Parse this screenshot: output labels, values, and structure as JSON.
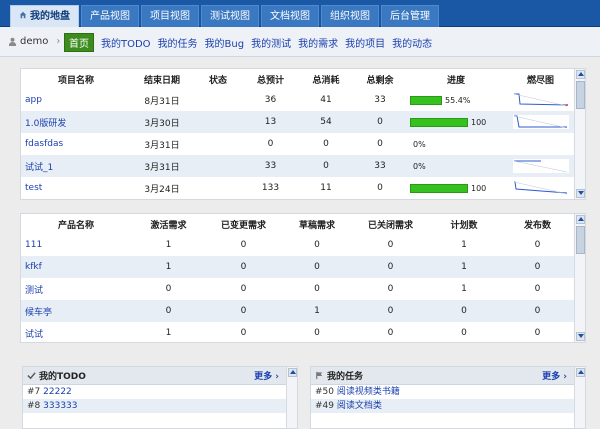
{
  "nav": {
    "tabs": [
      {
        "label": "我的地盘",
        "active": true
      },
      {
        "label": "产品视图"
      },
      {
        "label": "项目视图"
      },
      {
        "label": "测试视图"
      },
      {
        "label": "文档视图"
      },
      {
        "label": "组织视图"
      },
      {
        "label": "后台管理"
      }
    ]
  },
  "subnav": {
    "user": "demo",
    "separator": "›",
    "items": [
      "首页",
      "我的TODO",
      "我的任务",
      "我的Bug",
      "我的测试",
      "我的需求",
      "我的项目",
      "我的动态"
    ]
  },
  "projects": {
    "headers": [
      "项目名称",
      "结束日期",
      "状态",
      "总预计",
      "总消耗",
      "总剩余",
      "进度",
      "燃尽图"
    ],
    "rows": [
      {
        "name": "app",
        "end": "8月31日",
        "status": "",
        "estimate": "36",
        "consumed": "41",
        "left": "33",
        "progress": 55.4,
        "progress_label": "55.4%"
      },
      {
        "name": "1.0版研发",
        "end": "3月30日",
        "status": "",
        "estimate": "13",
        "consumed": "54",
        "left": "0",
        "progress": 100,
        "progress_label": "100"
      },
      {
        "name": "fdasfdas",
        "end": "3月31日",
        "status": "",
        "estimate": "0",
        "consumed": "0",
        "left": "0",
        "progress": 0,
        "progress_label": "0%"
      },
      {
        "name": "试试_1",
        "end": "3月31日",
        "status": "",
        "estimate": "33",
        "consumed": "0",
        "left": "33",
        "progress": 0,
        "progress_label": "0%"
      },
      {
        "name": "test",
        "end": "3月24日",
        "status": "",
        "estimate": "133",
        "consumed": "11",
        "left": "0",
        "progress": 100,
        "progress_label": "100"
      }
    ]
  },
  "products": {
    "headers": [
      "产品名称",
      "激活需求",
      "已变更需求",
      "草稿需求",
      "已关闭需求",
      "计划数",
      "发布数"
    ],
    "rows": [
      {
        "name": "111",
        "active": "1",
        "changed": "0",
        "draft": "0",
        "closed": "0",
        "plans": "1",
        "releases": "0"
      },
      {
        "name": "kfkf",
        "active": "1",
        "changed": "0",
        "draft": "0",
        "closed": "0",
        "plans": "1",
        "releases": "0"
      },
      {
        "name": "测试",
        "active": "0",
        "changed": "0",
        "draft": "0",
        "closed": "0",
        "plans": "1",
        "releases": "0"
      },
      {
        "name": "候车亭",
        "active": "0",
        "changed": "0",
        "draft": "1",
        "closed": "0",
        "plans": "0",
        "releases": "0"
      },
      {
        "name": "试试",
        "active": "1",
        "changed": "0",
        "draft": "0",
        "closed": "0",
        "plans": "0",
        "releases": "0"
      }
    ]
  },
  "todo": {
    "title": "我的TODO",
    "more": "更多",
    "items": [
      {
        "num": "#7",
        "text": "22222"
      },
      {
        "num": "#8",
        "text": "333333"
      }
    ]
  },
  "tasks": {
    "title": "我的任务",
    "more": "更多",
    "items": [
      {
        "num": "#50",
        "text": "阅读视频类书籍"
      },
      {
        "num": "#49",
        "text": "阅读文档类"
      }
    ]
  }
}
